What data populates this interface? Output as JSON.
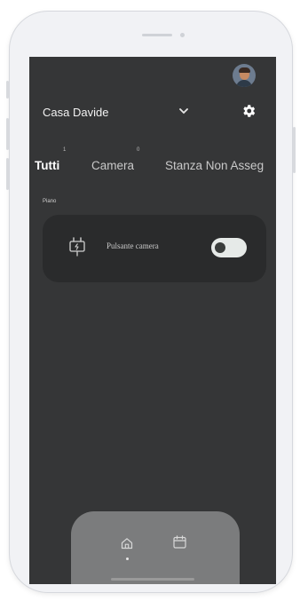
{
  "header": {
    "home_name": "Casa Davide",
    "avatar_icon": "user-avatar",
    "dropdown_icon": "chevron-down-icon",
    "settings_icon": "gear-icon"
  },
  "tabs": [
    {
      "label": "Tutti",
      "count": "1",
      "active": true
    },
    {
      "label": "Camera",
      "count": "0",
      "active": false
    },
    {
      "label": "Stanza Non Asseg",
      "count": "",
      "active": false
    }
  ],
  "section": {
    "label": "Piano"
  },
  "devices": [
    {
      "label": "Pulsante camera",
      "icon": "plug-icon",
      "state": "off"
    }
  ],
  "bottom_nav": {
    "items": [
      {
        "icon": "home-icon",
        "active": true
      },
      {
        "icon": "calendar-icon",
        "active": false
      }
    ]
  },
  "colors": {
    "screen_bg": "#353637",
    "card_bg": "#2a2b2c",
    "nav_bg": "#7b7c7d",
    "toggle_track": "#e6eae8"
  }
}
